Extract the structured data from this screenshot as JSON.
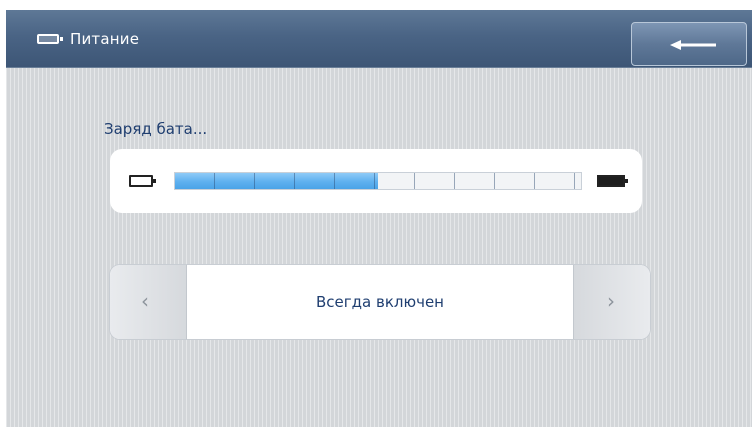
{
  "header": {
    "title": "Питание",
    "icon": "battery-icon",
    "back_icon": "arrow-left-icon"
  },
  "battery": {
    "label": "Заряд бата...",
    "level_percent": 50,
    "segments": 10,
    "empty_icon": "battery-empty-icon",
    "full_icon": "battery-full-icon"
  },
  "power_mode": {
    "value": "Всегда включен",
    "prev_icon": "chevron-left-icon",
    "next_icon": "chevron-right-icon"
  },
  "colors": {
    "header": "#4a6485",
    "progress_fill": "#5eb0ef",
    "text": "#1f3e70",
    "background": "#d7dadd"
  }
}
